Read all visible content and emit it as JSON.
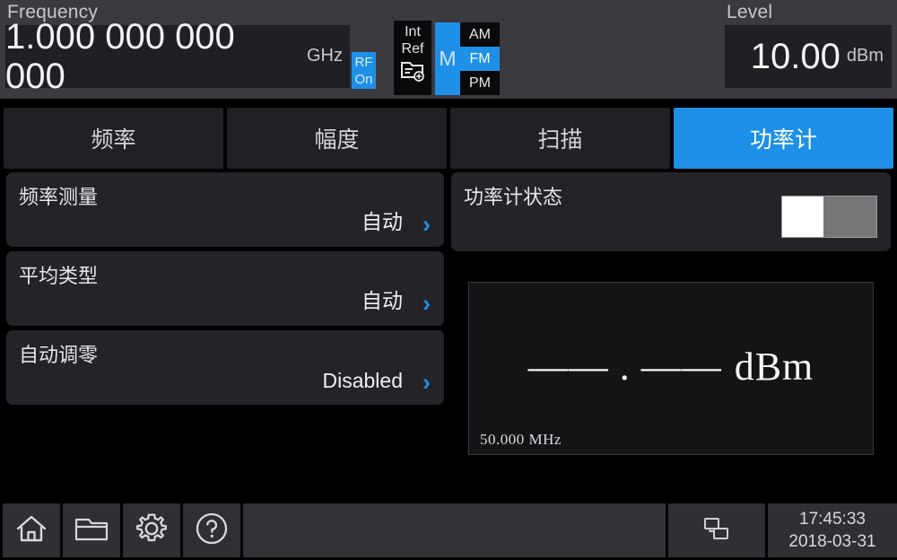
{
  "header": {
    "frequency_label": "Frequency",
    "frequency_value": "1.000 000 000 000",
    "frequency_unit": "GHz",
    "rf_badge_line1": "RF",
    "rf_badge_line2": "On",
    "ref_line1": "Int",
    "ref_line2": "Ref",
    "ref_icon": "file-add-icon",
    "mod_master": "M",
    "mod_items": [
      {
        "label": "AM",
        "active": false
      },
      {
        "label": "FM",
        "active": true
      },
      {
        "label": "PM",
        "active": false
      }
    ],
    "level_label": "Level",
    "level_value": "10.00",
    "level_unit": "dBm"
  },
  "tabs": [
    {
      "label": "频率",
      "active": false
    },
    {
      "label": "幅度",
      "active": false
    },
    {
      "label": "扫描",
      "active": false
    },
    {
      "label": "功率计",
      "active": true
    }
  ],
  "left_rows": [
    {
      "title": "频率测量",
      "value": "自动",
      "chevron": "›"
    },
    {
      "title": "平均类型",
      "value": "自动",
      "chevron": "›"
    },
    {
      "title": "自动调零",
      "value": "Disabled",
      "chevron": "›"
    }
  ],
  "right_panel": {
    "state_title": "功率计状态",
    "state_on": false,
    "measurement": {
      "reading": "—— . ——",
      "unit": "dBm",
      "frequency": "50.000 MHz"
    }
  },
  "statusbar": {
    "buttons": [
      {
        "icon": "home-icon",
        "name": "home-button"
      },
      {
        "icon": "folder-icon",
        "name": "folder-button"
      },
      {
        "icon": "gear-icon",
        "name": "settings-button"
      },
      {
        "icon": "help-icon",
        "name": "help-button"
      }
    ],
    "network_icon": "network-icon",
    "time": "17:45:33",
    "date": "2018-03-31"
  },
  "colors": {
    "accent": "#1e90e8",
    "panel": "#242428",
    "header_bg": "#3a3a3f",
    "background": "#000000"
  }
}
